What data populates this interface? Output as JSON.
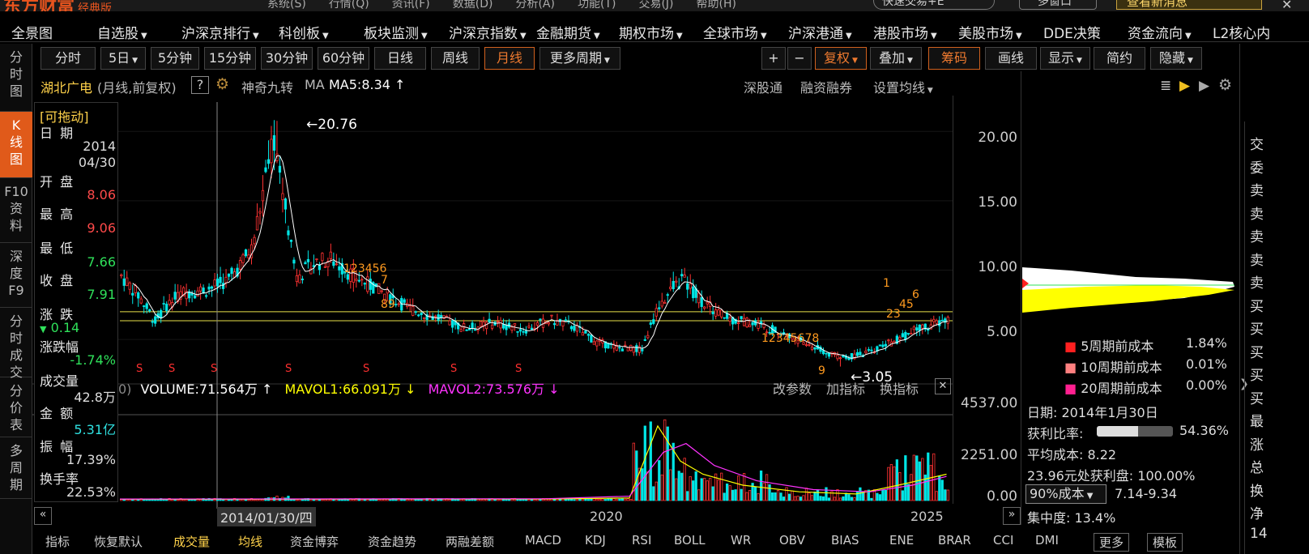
{
  "top_strip": {
    "app_name": "东方财富",
    "edition": "经典版",
    "menu": [
      "系统(S)",
      "行情(Q)",
      "资讯(F)",
      "数据(D)",
      "分析(A)",
      "功能(T)",
      "交易(J)",
      "帮助(H)"
    ],
    "quick_trade": "快速交易+E",
    "multi_screen": "多窗口",
    "news_button": "查看新消息"
  },
  "nav": {
    "items": [
      "全景图",
      "自选股",
      "沪深京排行",
      "科创板",
      "板块监测",
      "沪深京指数",
      "金融期货",
      "期权市场",
      "全球市场",
      "沪深港通",
      "港股市场",
      "美股市场",
      "DDE决策",
      "资金流向",
      "L2核心内"
    ]
  },
  "left_tabs": [
    {
      "label": "分\n时\n图"
    },
    {
      "label": "K\n线\n图"
    },
    {
      "label": "F10\n资\n料"
    },
    {
      "label": "深\n度\nF9"
    },
    {
      "label": "分\n时\n成\n交"
    },
    {
      "label": "分\n价\n表"
    },
    {
      "label": "多\n周\n期"
    }
  ],
  "toolbar": {
    "periods": [
      "分时",
      "5日",
      "5分钟",
      "15分钟",
      "30分钟",
      "60分钟",
      "日线",
      "周线",
      "月线",
      "更多周期"
    ],
    "right_tools": [
      "+",
      "−",
      "复权",
      "叠加",
      "筹码",
      "画线",
      "显示",
      "简约",
      "隐藏"
    ]
  },
  "chart_header": {
    "stock": "湖北广电",
    "mode": "(月线,前复权)",
    "help": "?",
    "indicator": "神奇九转",
    "ma": "MA",
    "ma5": "MA5:8.34",
    "links": [
      "深股通",
      "融资融券",
      "设置均线"
    ]
  },
  "info_panel": {
    "draggable": "[可拖动]",
    "date_label": "日 期",
    "date_year": "2014",
    "date_md": "04/30",
    "open_label": "开 盘",
    "open": "8.06",
    "high_label": "最 高",
    "high": "9.06",
    "low_label": "最 低",
    "low": "7.66",
    "close_label": "收 盘",
    "close": "7.91",
    "change_label": "涨 跌",
    "change": "0.14",
    "pct_label": "涨跌幅",
    "pct": "-1.74%",
    "vol_label": "成交量",
    "vol": "42.8万",
    "amount_label": "金 额",
    "amount": "5.31亿",
    "amp_label": "振 幅",
    "amp": "17.39%",
    "turnover_label": "换手率",
    "turnover": "22.53%"
  },
  "price_axis": [
    "20.00",
    "15.00",
    "10.00",
    "5.00"
  ],
  "volume_axis": [
    "4537.00",
    "2251.00",
    "0.00"
  ],
  "annotations": {
    "high_mark": "20.76",
    "low_mark": "3.05"
  },
  "volume_header": {
    "prefix": "0)",
    "volume": "VOLUME:71.564万",
    "mavol1": "MAVOL1:66.091万",
    "mavol2": "MAVOL2:73.576万",
    "links": [
      "改参数",
      "加指标",
      "换指标"
    ]
  },
  "time_axis": {
    "cursor_date": "2014/01/30/四",
    "label_2020": "2020",
    "label_2025": "2025"
  },
  "chip_panel": {
    "rows": [
      {
        "label": "5周期前成本",
        "value": "1.84%",
        "color": "#ff2020"
      },
      {
        "label": "10周期前成本",
        "value": "0.01%",
        "color": "#ff8080"
      },
      {
        "label": "20周期前成本",
        "value": "0.00%",
        "color": "#ff2090"
      }
    ],
    "date": "日期: 2014年1月30日",
    "profit_label": "获利比率:",
    "profit_value": "54.36%",
    "profit_fraction": 0.5436,
    "avg_cost": "平均成本: 8.22",
    "profit_line": "23.96元处获利盘: 100.00%",
    "cost_select": "90%成本",
    "cost_range": "7.14-9.34",
    "concentration": "集中度: 13.4%"
  },
  "far_right": [
    "交",
    "委",
    "卖",
    "卖",
    "卖",
    "卖",
    "卖",
    "买",
    "买",
    "买",
    "买",
    "买",
    "最",
    "涨",
    "总",
    "换",
    "净",
    "14"
  ],
  "bottom_tabs": [
    "指标",
    "恢复默认",
    "成交量",
    "均线",
    "资金博弈",
    "资金趋势",
    "两融差额",
    "MACD",
    "KDJ",
    "RSI",
    "BOLL",
    "WR",
    "OBV",
    "BIAS",
    "ENE",
    "BRAR",
    "CCI",
    "DMI",
    "更多",
    "模板"
  ],
  "colors": {
    "up": "#ff3232",
    "down": "#00e5e5",
    "ma5": "#ffffff",
    "mavol1": "#ffff00",
    "mavol2": "#ff33ff",
    "accent": "#e05a1a"
  },
  "chart_data": {
    "type": "candlestick",
    "period": "monthly",
    "price_range": [
      2.5,
      22.0
    ],
    "volume_range": [
      0,
      4800
    ],
    "date_labels": [
      "2014/01/30/四",
      "2020",
      "2025"
    ],
    "key_levels": {
      "high": 20.76,
      "low": 3.05
    },
    "price_gridlines": [
      20,
      15,
      10,
      5
    ]
  }
}
